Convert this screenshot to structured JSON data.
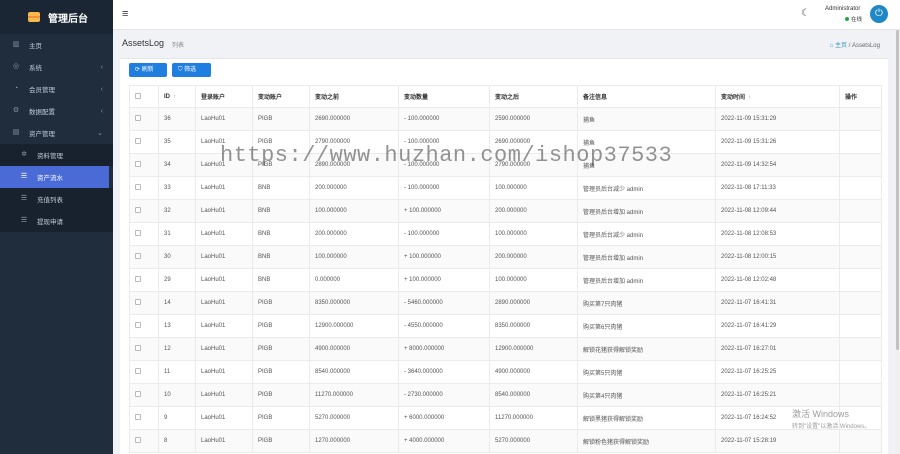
{
  "app": {
    "title": "管理后台"
  },
  "sidebar": {
    "items": [
      {
        "label": "主页",
        "icon": "dashboard-icon",
        "glyph": "▥"
      },
      {
        "label": "系统",
        "icon": "globe-icon",
        "glyph": "◎"
      },
      {
        "label": "会员管理",
        "icon": "user-icon",
        "glyph": "◔"
      },
      {
        "label": "数据配置",
        "icon": "users-icon",
        "glyph": "⚙"
      },
      {
        "label": "资产管理",
        "icon": "folder-icon",
        "glyph": "▤"
      }
    ],
    "sub_items": [
      {
        "label": "资料管理",
        "icon": "gear-icon",
        "glyph": "✲"
      },
      {
        "label": "资产流水",
        "icon": "list-icon",
        "glyph": "☰"
      },
      {
        "label": "充值列表",
        "icon": "list-icon",
        "glyph": "☰"
      },
      {
        "label": "提现申请",
        "icon": "list-icon",
        "glyph": "☰"
      }
    ]
  },
  "header": {
    "user_name": "Administrator",
    "user_status": "在线",
    "menu_glyph": "≡",
    "moon_glyph": "☾",
    "avatar_glyph": "⏻"
  },
  "page": {
    "title": "AssetsLog",
    "subtitle": "列表",
    "breadcrumb_home": "主页",
    "breadcrumb_sep": "/",
    "breadcrumb_current": "AssetsLog"
  },
  "toolbar": {
    "refresh_label": "⟳ 刷新",
    "filter_label": "⛉ 筛选"
  },
  "table": {
    "sort_glyph": "↑",
    "headers": [
      "ID",
      "登录账户",
      "变动账户",
      "变动之前",
      "变动数量",
      "变动之后",
      "备注信息",
      "变动时间",
      "操作"
    ],
    "rows": [
      [
        "36",
        "LaoHu01",
        "PIGB",
        "2690.000000",
        "- 100.000000",
        "2590.000000",
        "捕鱼",
        "2022-11-09 15:31:29"
      ],
      [
        "35",
        "LaoHu01",
        "PIGB",
        "2790.000000",
        "- 100.000000",
        "2690.000000",
        "捕鱼",
        "2022-11-09 15:31:26"
      ],
      [
        "34",
        "LaoHu01",
        "PIGB",
        "2890.000000",
        "- 100.000000",
        "2790.000000",
        "捕鱼",
        "2022-11-09 14:32:54"
      ],
      [
        "33",
        "LaoHu01",
        "BNB",
        "200.000000",
        "- 100.000000",
        "100.000000",
        "管理员后台减少 admin",
        "2022-11-08 17:11:33"
      ],
      [
        "32",
        "LaoHu01",
        "BNB",
        "100.000000",
        "+ 100.000000",
        "200.000000",
        "管理员后台增加 admin",
        "2022-11-08 12:09:44"
      ],
      [
        "31",
        "LaoHu01",
        "BNB",
        "200.000000",
        "- 100.000000",
        "100.000000",
        "管理员后台减少 admin",
        "2022-11-08 12:08:53"
      ],
      [
        "30",
        "LaoHu01",
        "BNB",
        "100.000000",
        "+ 100.000000",
        "200.000000",
        "管理员后台增加 admin",
        "2022-11-08 12:00:15"
      ],
      [
        "29",
        "LaoHu01",
        "BNB",
        "0.000000",
        "+ 100.000000",
        "100.000000",
        "管理员后台增加 admin",
        "2022-11-08 12:02:48"
      ],
      [
        "14",
        "LaoHu01",
        "PIGB",
        "8350.000000",
        "- 5460.000000",
        "2890.000000",
        "购买第7只肉猪",
        "2022-11-07 16:41:31"
      ],
      [
        "13",
        "LaoHu01",
        "PIGB",
        "12900.000000",
        "- 4550.000000",
        "8350.000000",
        "购买第6只肉猪",
        "2022-11-07 16:41:29"
      ],
      [
        "12",
        "LaoHu01",
        "PIGB",
        "4900.000000",
        "+ 8000.000000",
        "12900.000000",
        "解锁花猪获得解锁奖励",
        "2022-11-07 16:27:01"
      ],
      [
        "11",
        "LaoHu01",
        "PIGB",
        "8540.000000",
        "- 3640.000000",
        "4900.000000",
        "购买第5只肉猪",
        "2022-11-07 16:25:25"
      ],
      [
        "10",
        "LaoHu01",
        "PIGB",
        "11270.000000",
        "- 2730.000000",
        "8540.000000",
        "购买第4只肉猪",
        "2022-11-07 16:25:21"
      ],
      [
        "9",
        "LaoHu01",
        "PIGB",
        "5270.000000",
        "+ 6000.000000",
        "11270.000000",
        "解锁黑猪获得解锁奖励",
        "2022-11-07 16:24:52"
      ],
      [
        "8",
        "LaoHu01",
        "PIGB",
        "1270.000000",
        "+ 4000.000000",
        "5270.000000",
        "解锁粉色猪获得解锁奖励",
        "2022-11-07 15:28:19"
      ]
    ]
  },
  "overlay": {
    "watermark": "https://www.huzhan.com/ishop37533",
    "activate_title": "激活 Windows",
    "activate_sub": "转到\"设置\"以激活 Windows。"
  }
}
